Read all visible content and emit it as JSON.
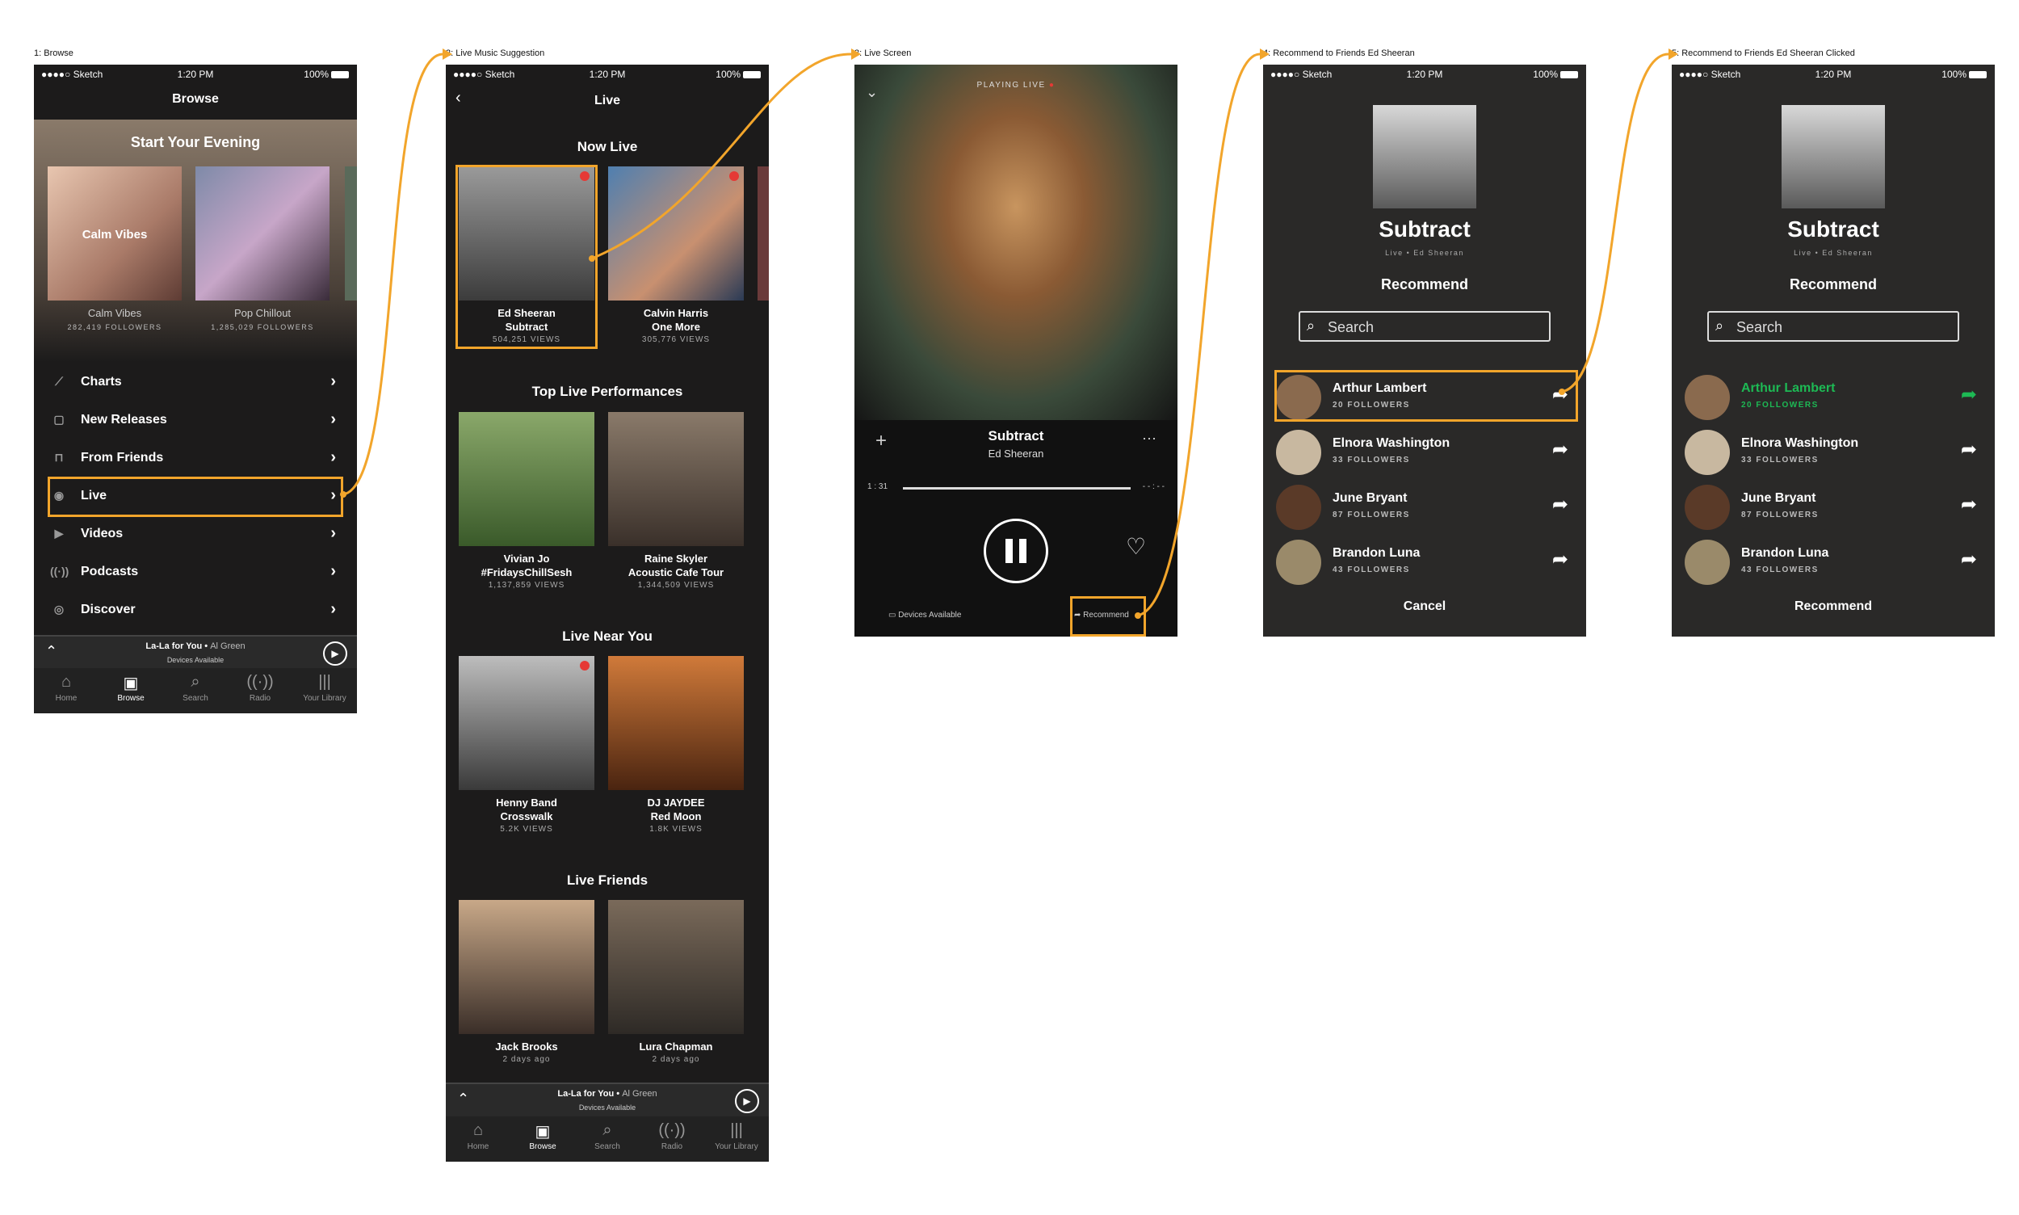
{
  "steps": {
    "s1": "1: Browse",
    "s2": "2: Live Music Suggestion",
    "s3": "3: Live Screen",
    "s4": "4: Recommend to Friends Ed Sheeran",
    "s5": "5: Recommend to Friends Ed Sheeran Clicked"
  },
  "status": {
    "carrier": "●●●●○ Sketch",
    "time": "1:20 PM",
    "battery": "100%"
  },
  "browse": {
    "title": "Browse",
    "hero": "Start Your Evening",
    "playlists": [
      {
        "name": "Calm Vibes",
        "overlay": "Calm Vibes",
        "followers": "282,419 FOLLOWERS"
      },
      {
        "name": "Pop Chillout",
        "followers": "1,285,029 FOLLOWERS"
      }
    ],
    "menu": [
      "Charts",
      "New Releases",
      "From Friends",
      "Live",
      "Videos",
      "Podcasts",
      "Discover"
    ]
  },
  "player": {
    "song": "La-La for You",
    "artist": "Al Green",
    "devices": "Devices Available"
  },
  "tabs": [
    "Home",
    "Browse",
    "Search",
    "Radio",
    "Your Library"
  ],
  "live": {
    "title": "Live",
    "now_live": "Now Live",
    "now": [
      {
        "l1": "Ed Sheeran",
        "l2": "Subtract",
        "l3": "504,251 VIEWS"
      },
      {
        "l1": "Calvin Harris",
        "l2": "One More",
        "l3": "305,776 VIEWS"
      }
    ],
    "top_title": "Top Live Performances",
    "top": [
      {
        "l1": "Vivian Jo",
        "l2": "#FridaysChillSesh",
        "l3": "1,137,859  VIEWS"
      },
      {
        "l1": "Raine Skyler",
        "l2": "Acoustic Cafe Tour",
        "l3": "1,344,509 VIEWS"
      }
    ],
    "near_title": "Live Near You",
    "near": [
      {
        "l1": "Henny Band",
        "l2": "Crosswalk",
        "l3": "5.2K VIEWS"
      },
      {
        "l1": "DJ JAYDEE",
        "l2": "Red Moon",
        "l3": "1.8K VIEWS"
      }
    ],
    "friends_title": "Live Friends",
    "friends": [
      {
        "l1": "Jack Brooks",
        "l3": "2 days ago"
      },
      {
        "l1": "Lura Chapman",
        "l3": "2 days ago"
      }
    ]
  },
  "livescreen": {
    "badge": "PLAYING LIVE",
    "song": "Subtract",
    "artist": "Ed Sheeran",
    "elapsed": "1 : 31",
    "remaining": "- - : - -",
    "devices": "Devices Available",
    "recommend": "Recommend",
    "more": "···",
    "add": "+"
  },
  "recommend": {
    "album": "Subtract",
    "sub": "Live • Ed Sheeran",
    "heading": "Recommend",
    "search_placeholder": "Search",
    "friends": [
      {
        "name": "Arthur Lambert",
        "followers": "20  FOLLOWERS"
      },
      {
        "name": "Elnora Washington",
        "followers": "33  FOLLOWERS"
      },
      {
        "name": "June Bryant",
        "followers": "87  FOLLOWERS"
      },
      {
        "name": "Brandon Luna",
        "followers": "43  FOLLOWERS"
      }
    ],
    "cancel": "Cancel",
    "recommend_btn": "Recommend"
  },
  "colors": {
    "accent": "#f2a52b",
    "green": "#1db954",
    "bg": "#1c1b1b"
  }
}
